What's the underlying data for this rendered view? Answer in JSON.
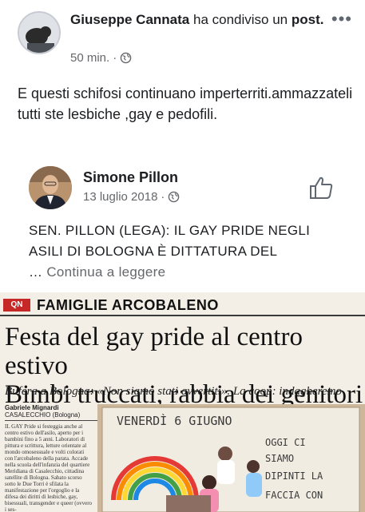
{
  "post": {
    "author": "Giuseppe Cannata",
    "action": " ha condiviso un ",
    "object": "post.",
    "time": "50 min.",
    "separator": "·",
    "text": "E questi schifosi continuano imperterriti.ammazzateli tutti ste lesbiche ,gay e pedofili."
  },
  "shared": {
    "author": "Simone Pillon",
    "date": "13 luglio 2018",
    "separator": "·",
    "text": "SEN. PILLON (LEGA): IL GAY PRIDE NEGLI ASILI DI BOLOGNA È DITTATURA DEL",
    "ellipsis": "… ",
    "continue": "Continua a leggere"
  },
  "clipping": {
    "logo": "QN",
    "section": "FAMIGLIE ARCOBALENO",
    "headline_line1": "Festa del gay pride al centro estivo",
    "headline_line2": "Bimbi truccati, rabbia dei genitori",
    "subhead": "Bufera a Bologna: «Non siamo stati avvertiti». La coop: indagheremo",
    "byline_name": "Gabriele Mignardi",
    "byline_place": "CASALECCHIO (Bologna)",
    "body": "IL GAY Pride si festeggia anche al centro estivo dell'asilo, aperto per i bambini fino a 5 anni. Laboratori di pittura e scrittura, letture orientate al mondo omosessuale e volti colorati con l'arcobaleno della parata. Accade nella scuola dell'infanzia del quartiere Meridiana di Casalecchio, cittadina satellite di Bologna. Sabato scorso sotto le Due Torri è sfilata la manifestazione per l'orgoglio e la difesa dei diritti di lesbiche, gay, bisessuali, transgender e queer (ovvero i ses-",
    "board_line1": "VENERDÌ  6  GIUGNO",
    "board_line2": "OGGI  CI",
    "board_line3": "SIAMO",
    "board_line4": "DIPINTI  LA",
    "board_line5": "FACCIA  CON"
  }
}
